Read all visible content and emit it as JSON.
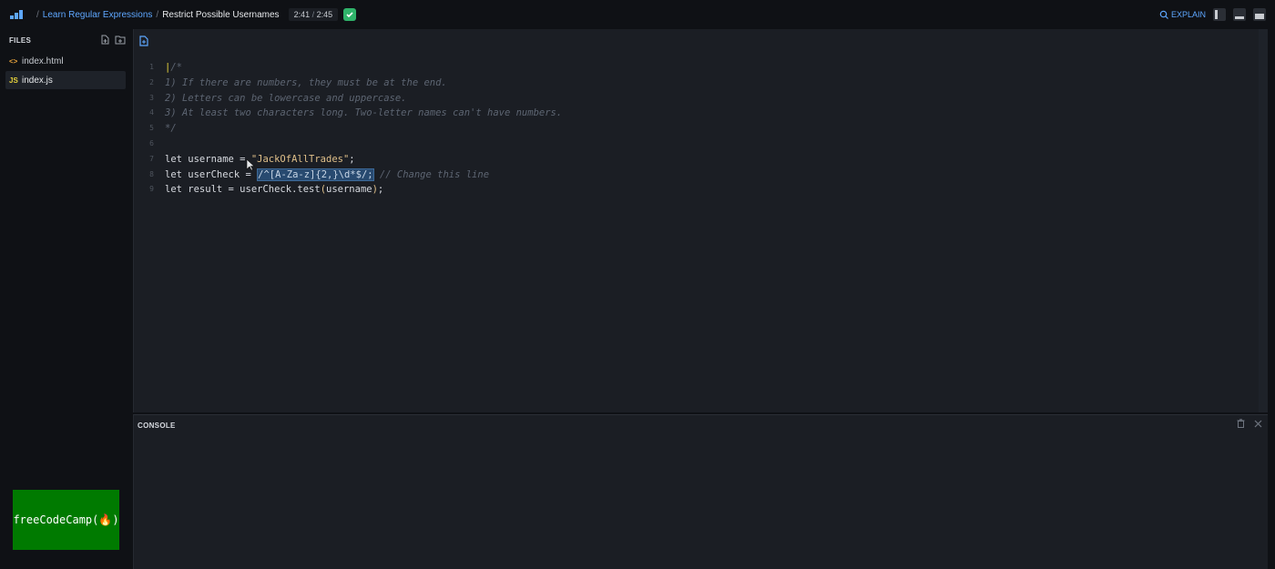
{
  "breadcrumb": {
    "course": "Learn Regular Expressions",
    "lesson": "Restrict Possible Usernames"
  },
  "timer": {
    "current": "2:41",
    "total": "2:45"
  },
  "top_right": {
    "explain_label": "EXPLAIN"
  },
  "sidebar": {
    "files_title": "FILES",
    "files": [
      {
        "name": "index.html",
        "icon": "<>"
      },
      {
        "name": "index.js",
        "icon": "JS"
      }
    ],
    "badge_label": "freeCodeCamp(🔥)"
  },
  "editor": {
    "line_numbers": [
      "1",
      "2",
      "3",
      "4",
      "5",
      "6",
      "7",
      "8",
      "9"
    ],
    "lines": {
      "l1": "/*",
      "l2": "1) If there are numbers, they must be at the end.",
      "l3": "2) Letters can be lowercase and uppercase.",
      "l4": "3) At least two characters long. Two-letter names can't have numbers.",
      "l5": "*/",
      "l7_kw": "let username = ",
      "l7_str": "\"JackOfAllTrades\"",
      "l7_end": ";",
      "l8_kw": "let userCheck = ",
      "l8_regex": "/^[A-Za-z]{2,}\\d*$/;",
      "l8_comment": " // Change this line",
      "l9_a": "let result = userCheck.test",
      "l9_b": "(",
      "l9_c": "username",
      "l9_d": ")",
      "l9_e": ";"
    }
  },
  "console": {
    "title": "CONSOLE"
  },
  "colors": {
    "background": "#0f1115",
    "editor_bg": "#1b1e24",
    "accent_link": "#5ea7ff",
    "success": "#2fb36a",
    "badge_green": "#007a00"
  }
}
